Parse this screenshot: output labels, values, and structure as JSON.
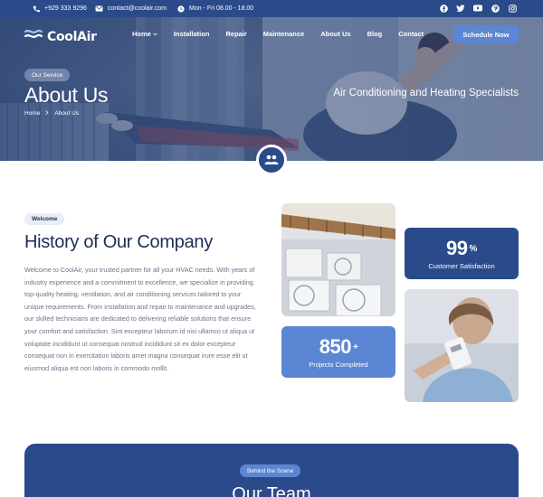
{
  "topbar": {
    "phone": "+929 333 9296",
    "email": "contact@coolair.com",
    "hours": "Mon - Fri 08.00 - 18.00",
    "social": [
      "facebook-icon",
      "twitter-icon",
      "youtube-icon",
      "pinterest-icon",
      "instagram-icon"
    ]
  },
  "brand": {
    "name": "CoolAir"
  },
  "nav": {
    "items": [
      {
        "label": "Home"
      },
      {
        "label": "Installation"
      },
      {
        "label": "Repair"
      },
      {
        "label": "Maintenance"
      },
      {
        "label": "About Us"
      },
      {
        "label": "Blog"
      },
      {
        "label": "Contact"
      }
    ],
    "cta": "Schedule Now"
  },
  "hero": {
    "badge": "Our Service",
    "title": "About Us",
    "breadcrumb": [
      "Home",
      "About Us"
    ],
    "tagline": "Air Conditioning and Heating Specialists"
  },
  "about": {
    "badge": "Welcome",
    "title": "History of Our Company",
    "paragraph": "Welcome to CoolAir, your trusted partner for all your HVAC needs. With years of industry experience and a commitment to excellence, we specialize in providing top-quality heating, ventilation, and air conditioning services tailored to your unique requirements. From installation and repair to maintenance and upgrades, our skilled technicians are dedicated to delivering reliable solutions that ensure your comfort and satisfaction. Sint excepteur laborum id nisi ullamco ut aliqua ut voluptate incididunt ut consequat nostrud incididunt sit ex dolor excepteur consequat non in exercitation laboris amet magna consequat irure esse elit ut eiusmod aliqua est non laboris in commodo mollit."
  },
  "stats": [
    {
      "value": "99",
      "suffix": "%",
      "label": "Customer Satisfaction"
    },
    {
      "value": "850",
      "suffix": "+",
      "label": "Projects Completed"
    }
  ],
  "team": {
    "badge": "Behind the Scene",
    "title": "Our Team"
  },
  "colors": {
    "primary": "#2a4a8a",
    "accent": "#5b86d3",
    "text": "#1f2f55",
    "muted": "#6c7488"
  }
}
